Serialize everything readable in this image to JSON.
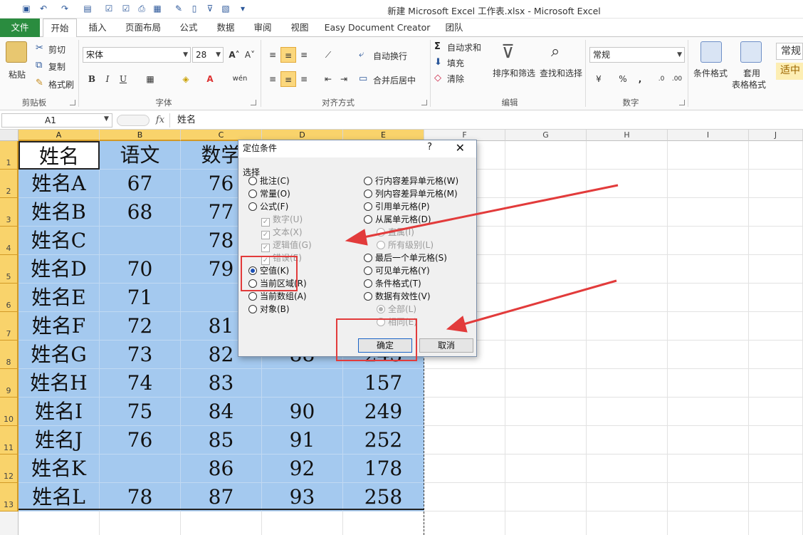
{
  "window": {
    "title": "新建 Microsoft Excel 工作表.xlsx  -  Microsoft Excel"
  },
  "tabs": [
    "文件",
    "开始",
    "插入",
    "页面布局",
    "公式",
    "数据",
    "审阅",
    "视图",
    "Easy Document Creator",
    "团队"
  ],
  "ribbon": {
    "clipboard": {
      "paste": "粘贴",
      "cut": "剪切",
      "copy": "复制",
      "format_painter": "格式刷",
      "label": "剪贴板"
    },
    "font": {
      "name": "宋体",
      "size": "28",
      "label": "字体"
    },
    "alignment": {
      "wrap": "自动换行",
      "merge": "合并后居中",
      "label": "对齐方式"
    },
    "editing": {
      "autosum": "自动求和",
      "fill": "填充",
      "clear": "清除",
      "sort": "排序和筛选",
      "find": "查找和选择",
      "label": "编辑"
    },
    "number": {
      "format": "常规",
      "label": "数字"
    },
    "styles": {
      "cond": "条件格式",
      "table1": "套用",
      "table2": "表格格式",
      "style1": "常规",
      "style2": "适中"
    }
  },
  "formula_bar": {
    "name_box": "A1",
    "fx": "fx",
    "value": "姓名"
  },
  "columns": [
    "A",
    "B",
    "C",
    "D",
    "E",
    "F",
    "G",
    "H",
    "I",
    "J"
  ],
  "rows": [
    "1",
    "2",
    "3",
    "4",
    "5",
    "6",
    "7",
    "8",
    "9",
    "10",
    "11",
    "12",
    "13"
  ],
  "cells": [
    [
      "姓名",
      "语文",
      "数学",
      "",
      ""
    ],
    [
      "姓名A",
      "67",
      "76",
      "",
      ""
    ],
    [
      "姓名B",
      "68",
      "77",
      "",
      ""
    ],
    [
      "姓名C",
      "",
      "78",
      "",
      ""
    ],
    [
      "姓名D",
      "70",
      "79",
      "",
      ""
    ],
    [
      "姓名E",
      "71",
      "",
      "",
      ""
    ],
    [
      "姓名F",
      "72",
      "81",
      "",
      ""
    ],
    [
      "姓名G",
      "73",
      "82",
      "88",
      "243"
    ],
    [
      "姓名H",
      "74",
      "83",
      "",
      "157"
    ],
    [
      "姓名I",
      "75",
      "84",
      "90",
      "249"
    ],
    [
      "姓名J",
      "76",
      "85",
      "91",
      "252"
    ],
    [
      "姓名K",
      "",
      "86",
      "92",
      "178"
    ],
    [
      "姓名L",
      "78",
      "87",
      "93",
      "258"
    ]
  ],
  "dialog": {
    "title": "定位条件",
    "help": "?",
    "close": "✕",
    "group": "选择",
    "left": [
      {
        "label": "批注(C)",
        "kind": "radio"
      },
      {
        "label": "常量(O)",
        "kind": "radio"
      },
      {
        "label": "公式(F)",
        "kind": "radio"
      },
      {
        "label": "数字(U)",
        "kind": "check"
      },
      {
        "label": "文本(X)",
        "kind": "check"
      },
      {
        "label": "逻辑值(G)",
        "kind": "check"
      },
      {
        "label": "错误(E)",
        "kind": "check"
      },
      {
        "label": "空值(K)",
        "kind": "radio",
        "selected": true
      },
      {
        "label": "当前区域(R)",
        "kind": "radio"
      },
      {
        "label": "当前数组(A)",
        "kind": "radio"
      },
      {
        "label": "对象(B)",
        "kind": "radio"
      }
    ],
    "right": [
      {
        "label": "行内容差异单元格(W)",
        "kind": "radio"
      },
      {
        "label": "列内容差异单元格(M)",
        "kind": "radio"
      },
      {
        "label": "引用单元格(P)",
        "kind": "radio"
      },
      {
        "label": "从属单元格(D)",
        "kind": "radio"
      },
      {
        "label": "直属(I)",
        "kind": "subradio"
      },
      {
        "label": "所有级别(L)",
        "kind": "subradio"
      },
      {
        "label": "最后一个单元格(S)",
        "kind": "radio"
      },
      {
        "label": "可见单元格(Y)",
        "kind": "radio"
      },
      {
        "label": "条件格式(T)",
        "kind": "radio"
      },
      {
        "label": "数据有效性(V)",
        "kind": "radio"
      },
      {
        "label": "全部(L)",
        "kind": "subradio",
        "selected": true
      },
      {
        "label": "相同(E)",
        "kind": "subradio"
      }
    ],
    "ok": "确定",
    "cancel": "取消"
  },
  "annotation_color": "#e23b3b",
  "selection_color": "#a4c9ef"
}
